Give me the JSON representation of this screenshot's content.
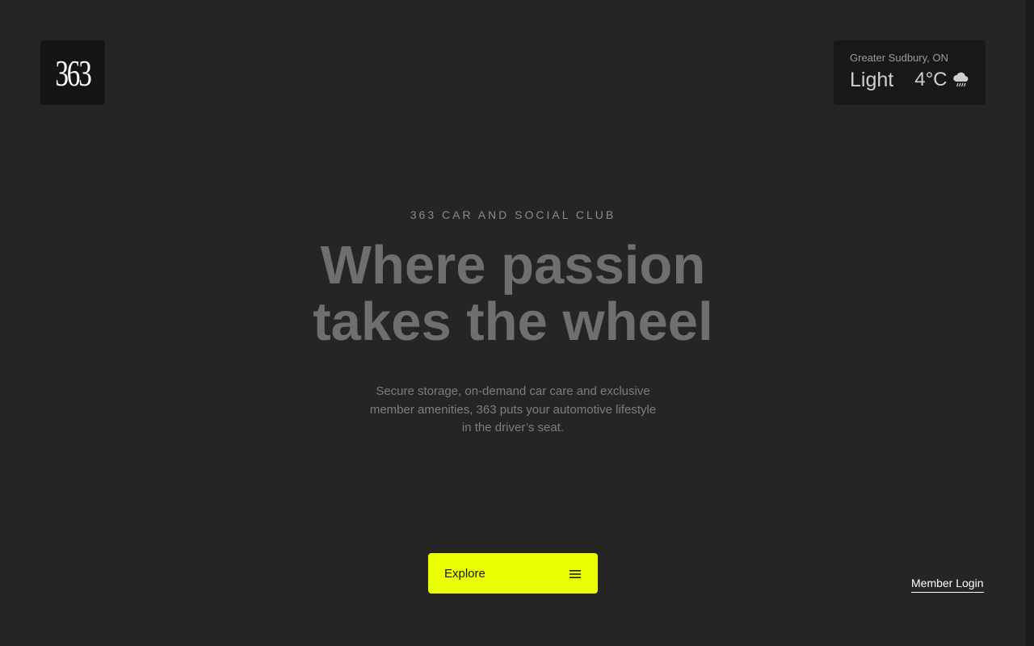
{
  "brand": {
    "logo_text": "363"
  },
  "weather": {
    "location": "Greater Sudbury, ON",
    "condition": "Light",
    "temperature": "4°C",
    "icon": "rain-cloud-icon"
  },
  "hero": {
    "eyebrow": "363 CAR AND SOCIAL CLUB",
    "headline_line1": "Where passion",
    "headline_line2": "takes the wheel",
    "description_line1": "Secure storage, on-demand car care and exclusive",
    "description_line2": "member amenities, 363 puts your automotive lifestyle",
    "description_line3": "in the driver’s seat."
  },
  "nav": {
    "explore_label": "Explore",
    "explore_icon": "menu-icon",
    "member_login_label": "Member Login"
  },
  "colors": {
    "background": "#252525",
    "accent": "#eaff00",
    "panel": "#181818"
  }
}
